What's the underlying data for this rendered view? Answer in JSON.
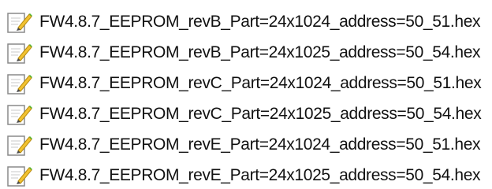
{
  "files": [
    {
      "name": "FW4.8.7_EEPROM_revB_Part=24x1024_address=50_51.hex",
      "icon": "edit-document-icon"
    },
    {
      "name": "FW4.8.7_EEPROM_revB_Part=24x1025_address=50_54.hex",
      "icon": "edit-document-icon"
    },
    {
      "name": "FW4.8.7_EEPROM_revC_Part=24x1024_address=50_51.hex",
      "icon": "edit-document-icon"
    },
    {
      "name": "FW4.8.7_EEPROM_revC_Part=24x1025_address=50_54.hex",
      "icon": "edit-document-icon"
    },
    {
      "name": "FW4.8.7_EEPROM_revE_Part=24x1024_address=50_51.hex",
      "icon": "edit-document-icon"
    },
    {
      "name": "FW4.8.7_EEPROM_revE_Part=24x1025_address=50_54.hex",
      "icon": "edit-document-icon"
    }
  ],
  "colors": {
    "text": "#111111",
    "paper": "#ffffff",
    "paper_border": "#8a8a8a",
    "pencil_yellow": "#f2c230",
    "pencil_green": "#55b82f",
    "pencil_tip": "#4a4a4a"
  }
}
